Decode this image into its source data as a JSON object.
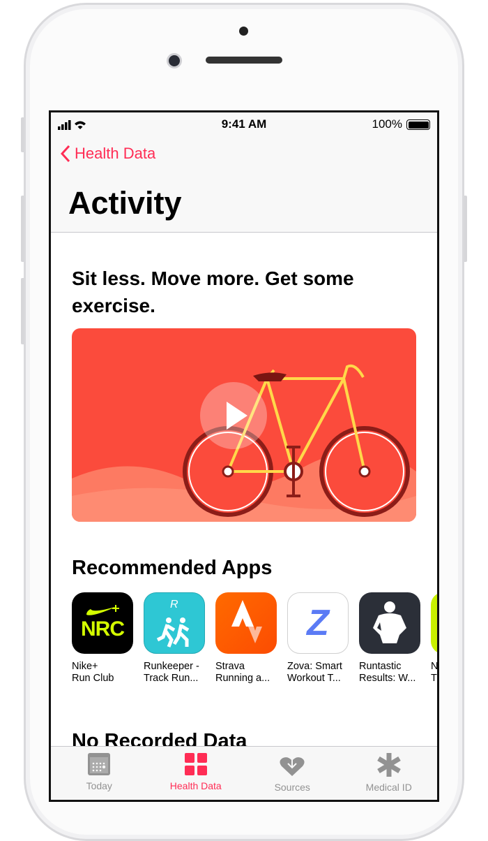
{
  "status_bar": {
    "time": "9:41 AM",
    "battery": "100%"
  },
  "nav": {
    "back_label": "Health Data",
    "title": "Activity"
  },
  "content": {
    "headline": "Sit less. Move more. Get some exercise.",
    "recommended_title": "Recommended Apps",
    "apps": [
      {
        "line1": "Nike+",
        "line2": "Run Club",
        "icon_text": "NRC"
      },
      {
        "line1": "Runkeeper -",
        "line2": "Track Run..."
      },
      {
        "line1": "Strava",
        "line2": "Running a..."
      },
      {
        "line1": "Zova: Smart",
        "line2": "Workout T...",
        "icon_text": "Z"
      },
      {
        "line1": "Runtastic",
        "line2": "Results: W..."
      },
      {
        "line1": "N",
        "line2": "T"
      }
    ],
    "no_data_title": "No Recorded Data"
  },
  "tabs": [
    {
      "label": "Today",
      "icon": "calendar-icon",
      "active": false
    },
    {
      "label": "Health Data",
      "icon": "grid-icon",
      "active": true
    },
    {
      "label": "Sources",
      "icon": "heart-download-icon",
      "active": false
    },
    {
      "label": "Medical ID",
      "icon": "asterisk-icon",
      "active": false
    }
  ],
  "colors": {
    "accent": "#ff2d55",
    "video_bg": "#fb4b3c",
    "inactive_tab": "#929292"
  }
}
